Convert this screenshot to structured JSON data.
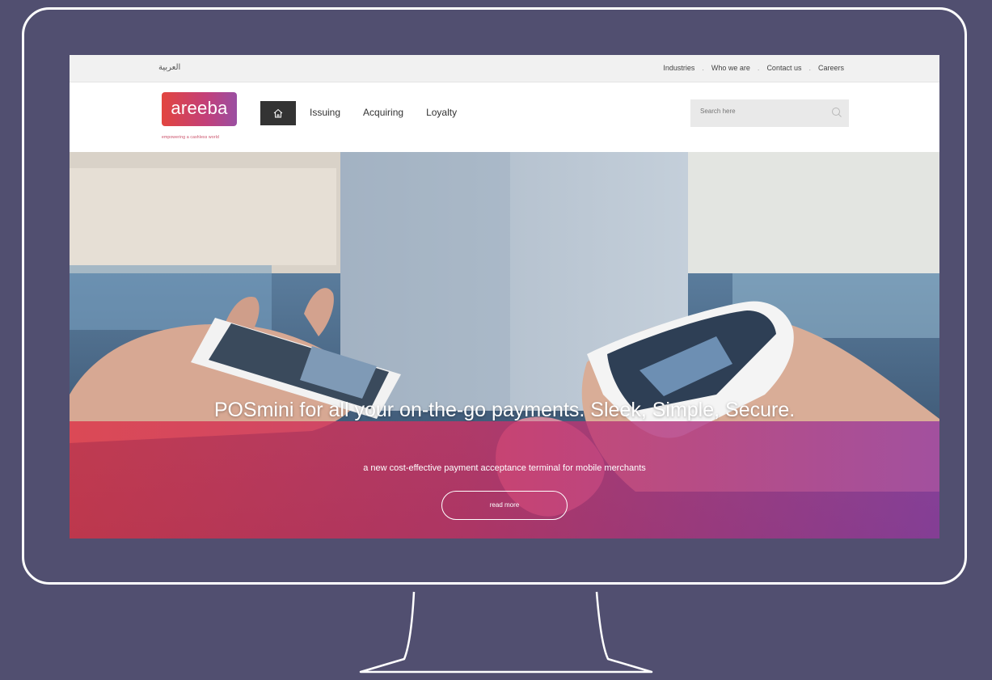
{
  "utility_bar": {
    "language_label": "العربية",
    "links": [
      "Industries",
      "Who we are",
      "Contact us",
      "Careers"
    ]
  },
  "header": {
    "logo_text": "areeba",
    "tagline": "empowering a cashless world",
    "nav": [
      "Issuing",
      "Acquiring",
      "Loyalty"
    ],
    "search_placeholder": "Search here"
  },
  "hero": {
    "title": "POSmini for all your on-the-go payments. Sleek, Simple, Secure.",
    "subtitle": "a new cost-effective payment acceptance terminal for mobile merchants",
    "cta_label": "read more"
  },
  "colors": {
    "background": "#514f70",
    "brand_red": "#e2453f",
    "brand_purple": "#9a4fa2",
    "nav_dark": "#333333"
  },
  "icons": [
    "home-icon",
    "search-icon"
  ]
}
